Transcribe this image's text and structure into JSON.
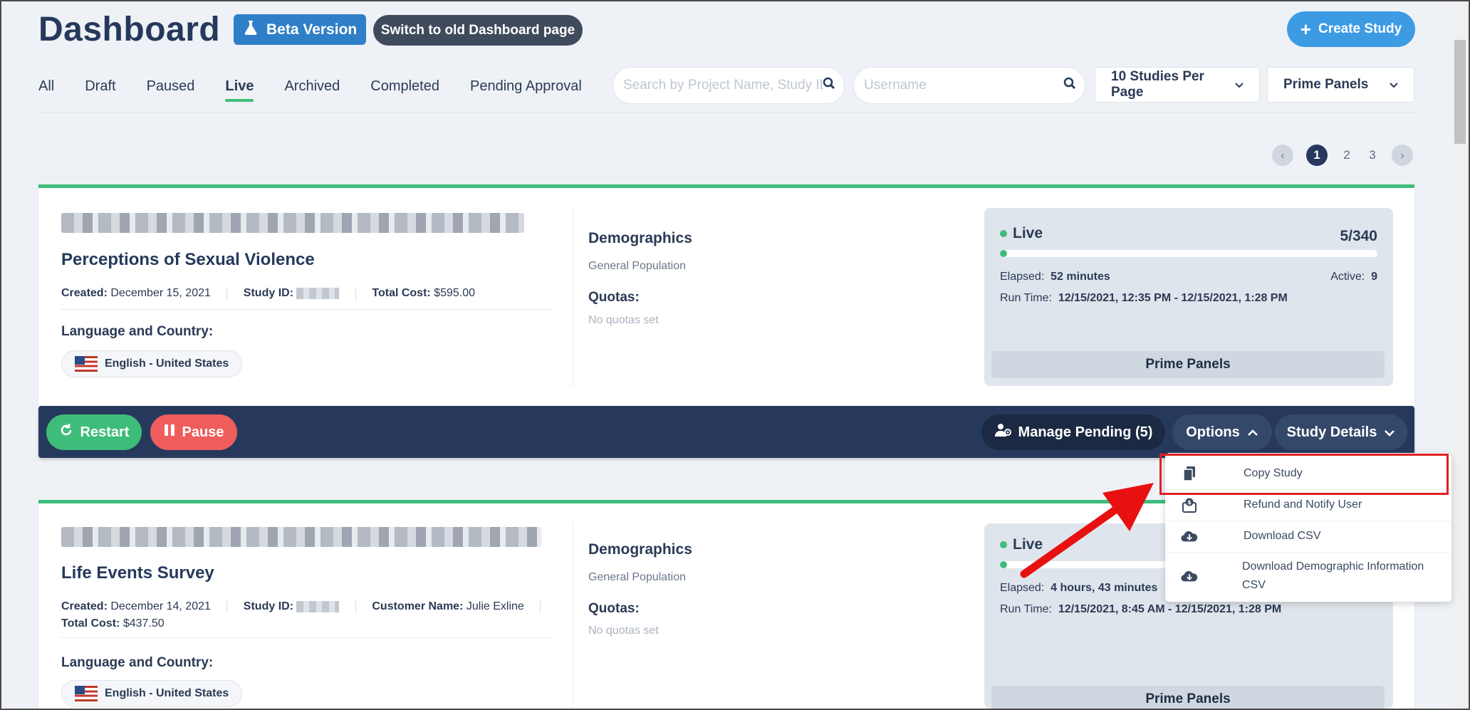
{
  "header": {
    "title": "Dashboard",
    "beta_label": "Beta Version",
    "old_dashboard_label": "Switch to old Dashboard page",
    "create_label": "Create Study"
  },
  "tabs": [
    {
      "label": "All",
      "active": false
    },
    {
      "label": "Draft",
      "active": false
    },
    {
      "label": "Paused",
      "active": false
    },
    {
      "label": "Live",
      "active": true
    },
    {
      "label": "Archived",
      "active": false
    },
    {
      "label": "Completed",
      "active": false
    },
    {
      "label": "Pending Approval",
      "active": false
    }
  ],
  "filters": {
    "project_search_placeholder": "Search by Project Name, Study ID",
    "username_placeholder": "Username",
    "per_page": "10 Studies Per Page",
    "panel": "Prime Panels"
  },
  "pagination": {
    "pages": [
      "1",
      "2",
      "3"
    ],
    "current": "1"
  },
  "studies": [
    {
      "title": "Perceptions of Sexual Violence",
      "created_label": "Created:",
      "created": "December 15, 2021",
      "study_id_label": "Study ID:",
      "cost_label": "Total Cost:",
      "total_cost": "$595.00",
      "lang_heading": "Language and Country:",
      "language": "English - United States",
      "demographics_heading": "Demographics",
      "demographics": "General Population",
      "quotas_heading": "Quotas:",
      "quotas": "No quotas set",
      "status": "Live",
      "count": "5/340",
      "progress": 0.0147,
      "elapsed_label": "Elapsed:",
      "elapsed": "52 minutes",
      "active_label": "Active:",
      "active": "9",
      "runtime_label": "Run Time:",
      "runtime": "12/15/2021, 12:35 PM - 12/15/2021, 1:28 PM",
      "panel": "Prime Panels"
    },
    {
      "title": "Life Events Survey",
      "created_label": "Created:",
      "created": "December 14, 2021",
      "study_id_label": "Study ID:",
      "customer_label": "Customer Name:",
      "customer": "Julie Exline",
      "cost_label": "Total Cost:",
      "total_cost": "$437.50",
      "lang_heading": "Language and Country:",
      "language": "English - United States",
      "demographics_heading": "Demographics",
      "demographics": "General Population",
      "quotas_heading": "Quotas:",
      "quotas": "No quotas set",
      "status": "Live",
      "elapsed_label": "Elapsed:",
      "elapsed": "4 hours, 43 minutes",
      "runtime_label": "Run Time:",
      "runtime": "12/15/2021, 8:45 AM - 12/15/2021, 1:28 PM",
      "panel": "Prime Panels"
    }
  ],
  "actions": {
    "restart": "Restart",
    "pause": "Pause",
    "manage_pending": "Manage Pending (5)",
    "options": "Options",
    "study_details": "Study Details"
  },
  "options_menu": [
    {
      "label": "Copy Study",
      "icon": "copy-icon"
    },
    {
      "label": "Refund and Notify User",
      "icon": "refund-icon"
    },
    {
      "label": "Download CSV",
      "icon": "cloud-download-icon"
    },
    {
      "label": "Download Demographic Information CSV",
      "icon": "cloud-download-icon"
    }
  ],
  "colors": {
    "accent_green": "#3ebd7a",
    "navy": "#26395c",
    "blue": "#3d9be4",
    "red": "#ef5d5d",
    "highlight": "#e02020"
  }
}
